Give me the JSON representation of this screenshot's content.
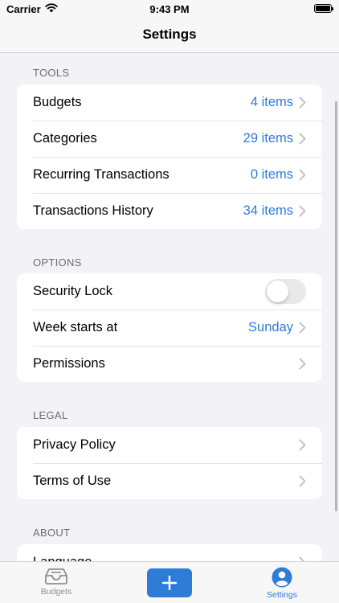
{
  "status_bar": {
    "carrier": "Carrier",
    "time": "9:43 PM"
  },
  "nav": {
    "title": "Settings"
  },
  "sections": {
    "tools": {
      "header": "TOOLS",
      "rows": [
        {
          "label": "Budgets",
          "value": "4 items"
        },
        {
          "label": "Categories",
          "value": "29 items"
        },
        {
          "label": "Recurring Transactions",
          "value": "0 items"
        },
        {
          "label": "Transactions History",
          "value": "34 items"
        }
      ]
    },
    "options": {
      "header": "OPTIONS",
      "rows": [
        {
          "label": "Security Lock",
          "toggle_on": false
        },
        {
          "label": "Week starts at",
          "value": "Sunday"
        },
        {
          "label": "Permissions"
        }
      ]
    },
    "legal": {
      "header": "LEGAL",
      "rows": [
        {
          "label": "Privacy Policy"
        },
        {
          "label": "Terms of Use"
        }
      ]
    },
    "about": {
      "header": "ABOUT",
      "rows": [
        {
          "label": "Language"
        }
      ]
    }
  },
  "tab_bar": {
    "tabs": [
      {
        "label": "Budgets",
        "icon": "tray-icon",
        "selected": false
      },
      {
        "label": "Settings",
        "icon": "person-circle-icon",
        "selected": true
      }
    ],
    "add_icon": "plus-icon"
  },
  "colors": {
    "accent": "#2f7bd8",
    "background": "#f2f2f7",
    "secondary_text": "#6d6d72"
  }
}
